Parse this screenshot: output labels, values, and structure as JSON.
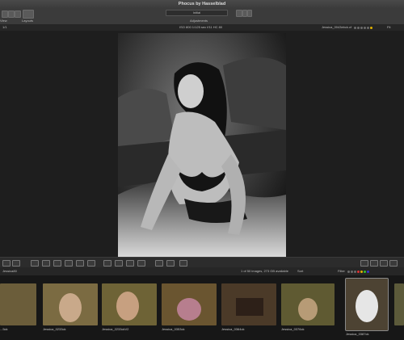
{
  "app": {
    "title": "Phocus by Hasselblad"
  },
  "toolbar": {
    "left_label_1": "View",
    "left_label_2": "Layouts",
    "preset_value": "Initial",
    "center_label": "Adjustments"
  },
  "infobar": {
    "left_num": "1/1",
    "capture_info": "ISO 800  1/125 sec  f/11  HC 80",
    "file_name": "Jessica_0043ebck.cf",
    "zoom": "Fit"
  },
  "browser": {
    "folder": "Jessica80",
    "count_text": "1 of 50 images, 273 GB available",
    "sort_label": "Sort",
    "filter_label": "Filter"
  },
  "thumbnails": [
    {
      "caption": "...5ck",
      "selected": false,
      "color": "#6b5d3a"
    },
    {
      "caption": "Jessica_0233ck",
      "selected": false,
      "color": "#7b6b42"
    },
    {
      "caption": "Jessica_2233ckV2",
      "selected": false,
      "color": "#6e6336"
    },
    {
      "caption": "Jessica_0353ck",
      "selected": false,
      "color": "#6a5530"
    },
    {
      "caption": "Jessica_0364ck",
      "selected": false,
      "color": "#4b3a28"
    },
    {
      "caption": "Jessica_0376ck",
      "selected": false,
      "color": "#5f5a32"
    },
    {
      "caption": "Jessica_0387ck",
      "selected": true,
      "color": "#4d4333"
    },
    {
      "caption": "...",
      "selected": false,
      "color": "#5c5a3a"
    }
  ],
  "colors": {
    "accent": "#3b3b3b",
    "photo_bg": "#111111"
  }
}
